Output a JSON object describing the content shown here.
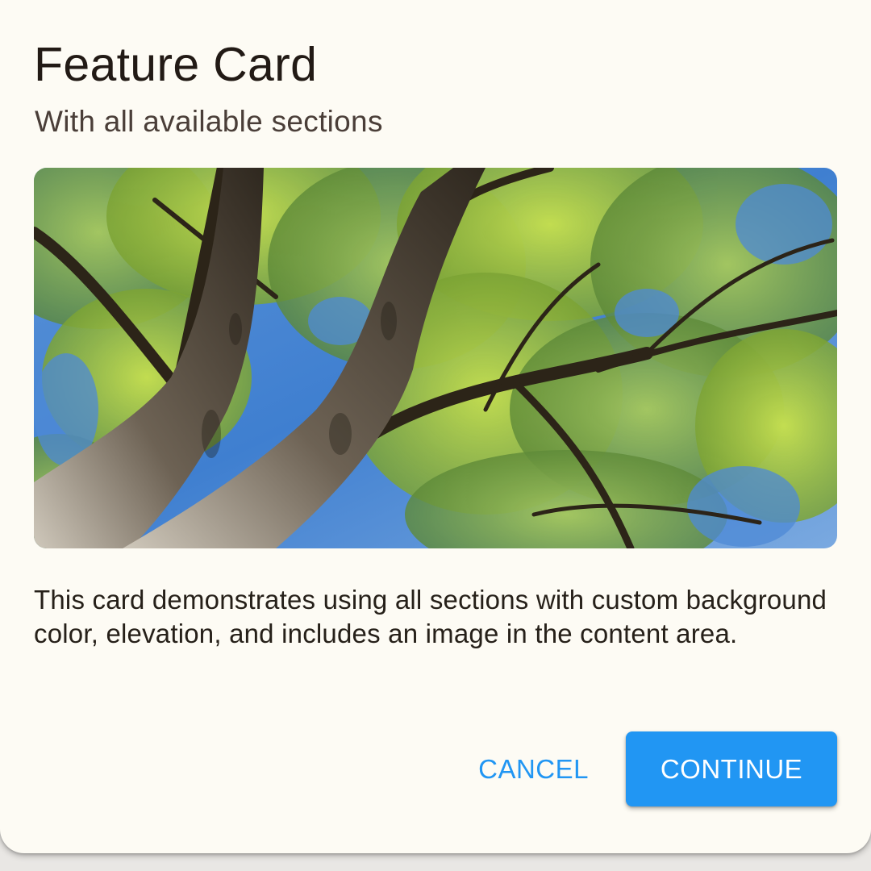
{
  "card": {
    "title": "Feature Card",
    "subtitle": "With all available sections",
    "image_icon": "tree-canopy-photo",
    "body": "This card demonstrates using all sections with custom background color, elevation, and includes an image in the content area.",
    "actions": {
      "cancel_label": "CANCEL",
      "continue_label": "CONTINUE"
    }
  },
  "colors": {
    "card_background": "#fdfbf4",
    "accent": "#2196f3",
    "title_text": "#221a15",
    "subtitle_text": "#4a3e38"
  }
}
